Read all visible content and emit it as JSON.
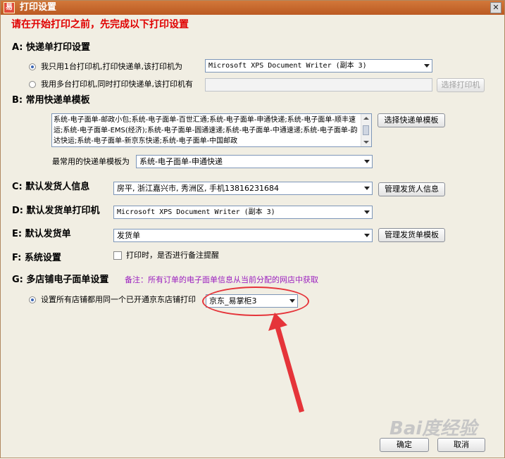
{
  "window": {
    "title": "打印设置",
    "app_icon_glyph": "易",
    "close_glyph": "✕"
  },
  "warning": "请在开始打印之前，先完成以下打印设置",
  "section_a": {
    "title": "A: 快递单打印设置",
    "option_single": "我只用1台打印机,打印快递单,该打印机为",
    "option_single_printer": "Microsoft XPS Document Writer (副本 3)",
    "option_multi": "我用多台打印机,同时打印快递单,该打印机有",
    "option_multi_value": "",
    "select_printer_btn": "选择打印机"
  },
  "section_b": {
    "title": "B: 常用快递单模板",
    "templates_text": "系统-电子面单-邮政小包;系统-电子面单-百世汇通;系统-电子面单-申通快递;系统-电子面单-顺丰速运;系统-电子面单-EMS(经济);系统-电子面单-圆通速递;系统-电子面单-中通速递;系统-电子面单-韵达快运;系统-电子面单-新京东快递;系统-电子面单-中国邮政",
    "select_template_btn": "选择快递单模板",
    "most_used_label": "最常用的快递单模板为",
    "most_used_value": "系统-电子面单-申通快递"
  },
  "section_c": {
    "title": "C: 默认发货人信息",
    "value": "房平, 浙江嘉兴市, 秀洲区, 手机13816231684",
    "manage_btn": "管理发货人信息"
  },
  "section_d": {
    "title": "D: 默认发货单打印机",
    "value": "Microsoft XPS Document Writer (副本 3)"
  },
  "section_e": {
    "title": "E: 默认发货单",
    "value": "发货单",
    "manage_btn": "管理发货单模板"
  },
  "section_f": {
    "title": "F: 系统设置",
    "checkbox_label": "打印时，是否进行备注提醒"
  },
  "section_g": {
    "title": "G: 多店铺电子面单设置",
    "note": "备注：所有订单的电子面单信息从当前分配的网店中获取",
    "option_label": "设置所有店铺都用同一个已开通京东店铺打印",
    "store_value": "京东_易掌柜3"
  },
  "buttons": {
    "ok": "确定",
    "cancel": "取消"
  },
  "watermark": "Bai度经验",
  "colors": {
    "annotation_red": "#e5343a",
    "warning_red": "#e00000",
    "note_purple": "#9b1fbf"
  }
}
